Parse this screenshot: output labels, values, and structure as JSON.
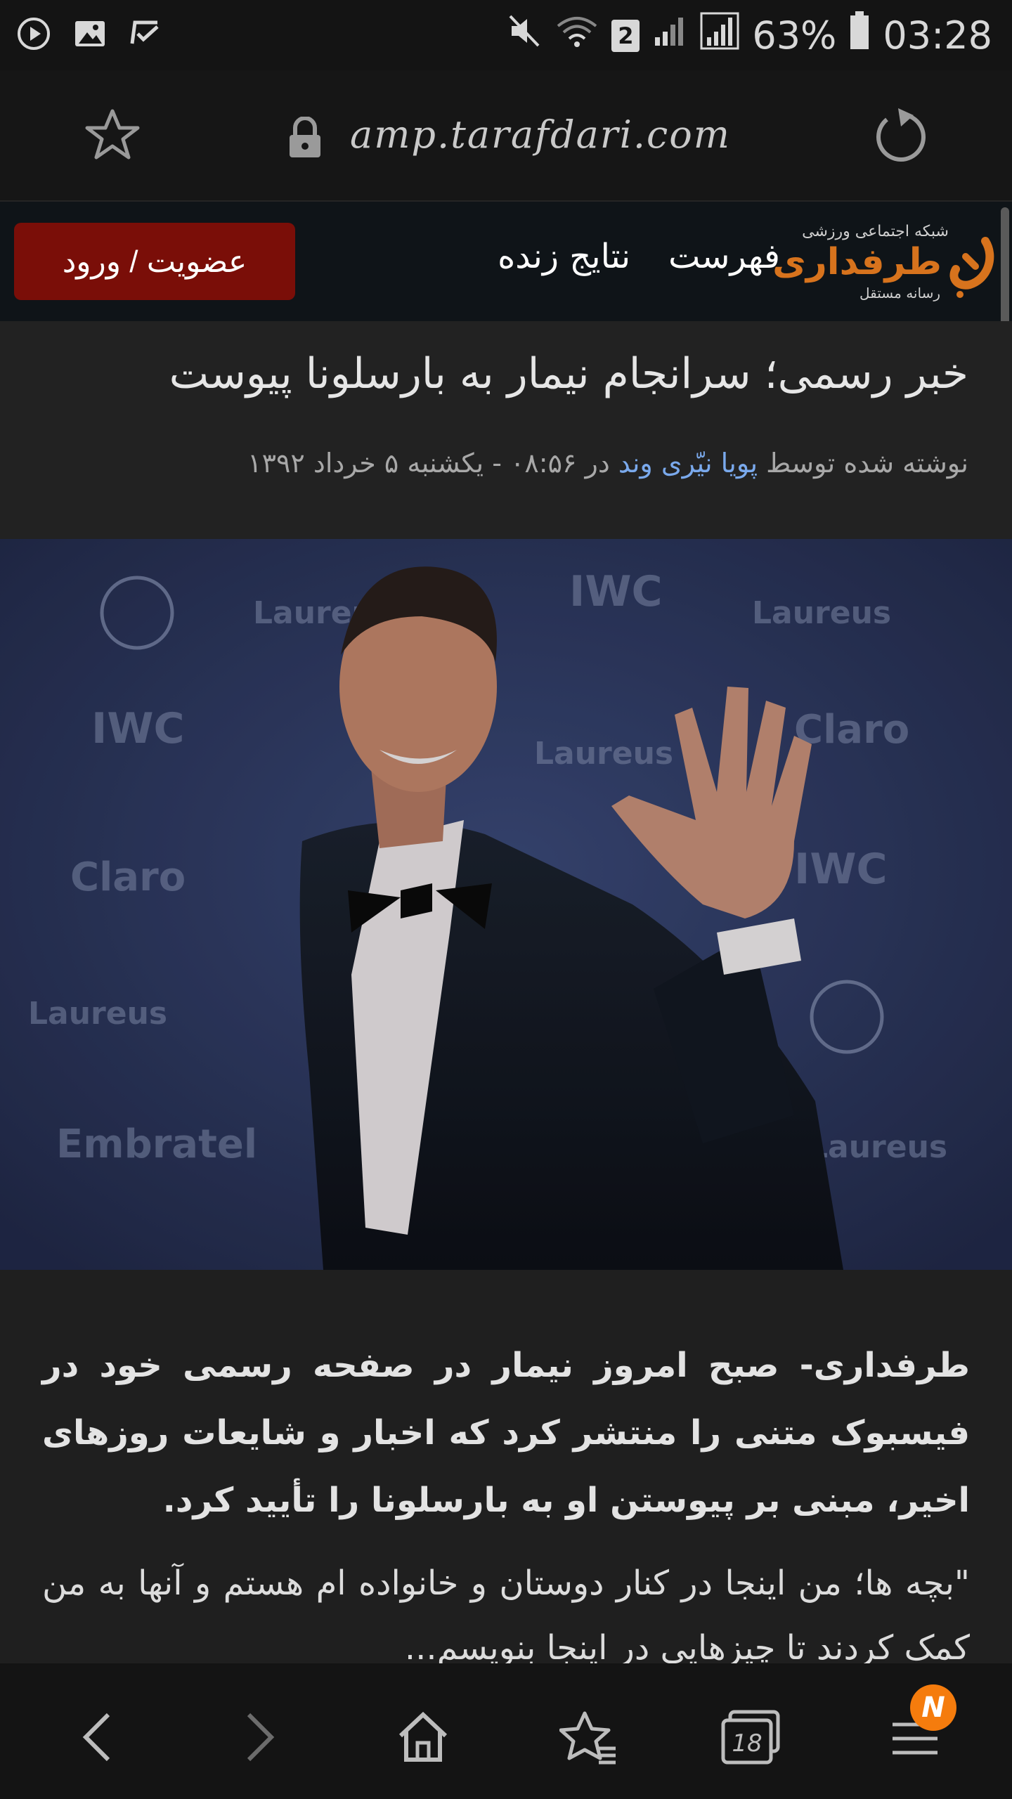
{
  "status_bar": {
    "battery": "63%",
    "time": "03:28",
    "sim_slot": "2"
  },
  "browser": {
    "url": "amp.tarafdari.com"
  },
  "site_nav": {
    "brand_tagline_top": "شبکه اجتماعی ورزشی",
    "brand_name": "طرفداری",
    "brand_tagline_bottom": "رسانه مستقل",
    "links": [
      "فهرست",
      "نتایج زنده"
    ],
    "login_label": "عضویت / ورود"
  },
  "article": {
    "headline": "خبر رسمی؛ سرانجام نیمار به بارسلونا پیوست",
    "byline_prefix": "نوشته شده توسط",
    "author": "پویا نیّری وند",
    "byline_suffix": "در ۰۸:۵۶ - یکشنبه ۵ خرداد ۱۳۹۲",
    "lead": "طرفداری- صبح امروز نیمار در صفحه رسمی خود در فیسبوک متنی را منتشر کرد که اخبار و شایعات روزهای اخیر، مبنی بر پیوستن او به بارسلونا را تأیید کرد.",
    "paragraph": "\"بچه ها؛ من اینجا در کنار دوستان و خانواده ام هستم و آنها به من کمک کردند تا چیزهایی در اینجا بنویسم..."
  },
  "bottom_bar": {
    "tabs_count": "18",
    "notification_badge": "N"
  },
  "colors": {
    "login_button": "#7a0e08",
    "brand_orange": "#d7731d",
    "author_link": "#7aa9ec",
    "badge": "#f57c0d"
  }
}
